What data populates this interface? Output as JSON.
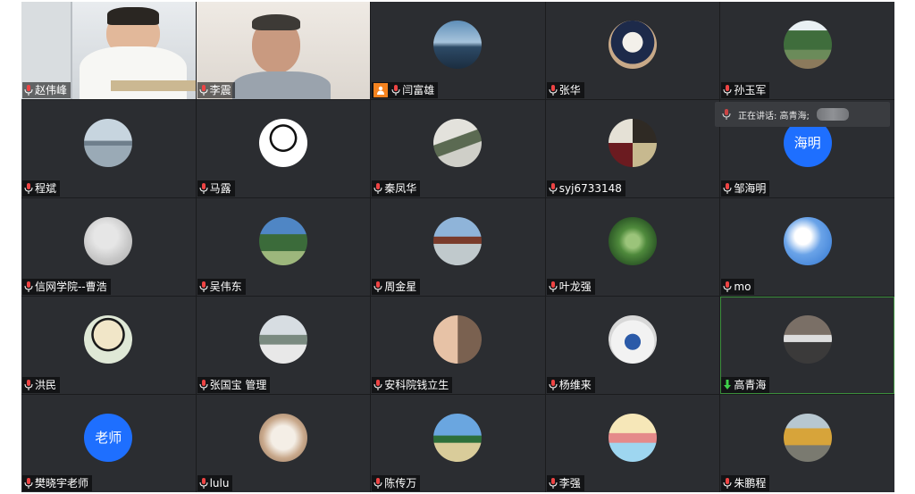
{
  "participants": [
    {
      "name": "赵伟峰",
      "kind": "video",
      "scene": "man-desk"
    },
    {
      "name": "李震",
      "kind": "video",
      "scene": "older-man"
    },
    {
      "name": "闫富雄",
      "kind": "photo",
      "scene": "lighthouse",
      "host": true
    },
    {
      "name": "张华",
      "kind": "photo",
      "scene": "cat"
    },
    {
      "name": "孙玉军",
      "kind": "photo",
      "scene": "forest"
    },
    {
      "name": "程斌",
      "kind": "photo",
      "scene": "city-lake"
    },
    {
      "name": "马露",
      "kind": "photo",
      "scene": "cartoon-boy"
    },
    {
      "name": "秦凤华",
      "kind": "photo",
      "scene": "office"
    },
    {
      "name": "syj6733148",
      "kind": "photo",
      "scene": "grid-tiles"
    },
    {
      "name": "邹海明",
      "kind": "text",
      "avatar_text": "海明",
      "color": "#1e6fff"
    },
    {
      "name": "信网学院--曹浩",
      "kind": "photo",
      "scene": "grey-ball"
    },
    {
      "name": "吴伟东",
      "kind": "photo",
      "scene": "garden"
    },
    {
      "name": "周金星",
      "kind": "photo",
      "scene": "pavilion"
    },
    {
      "name": "叶龙强",
      "kind": "photo",
      "scene": "succulent"
    },
    {
      "name": "mo",
      "kind": "photo",
      "scene": "sky"
    },
    {
      "name": "洪民",
      "kind": "photo",
      "scene": "cartoon-glasses"
    },
    {
      "name": "张国宝 管理",
      "kind": "photo",
      "scene": "building"
    },
    {
      "name": "安科院钱立生",
      "kind": "photo",
      "scene": "couple"
    },
    {
      "name": "杨维来",
      "kind": "photo",
      "scene": "kid"
    },
    {
      "name": "高青海",
      "kind": "photo",
      "scene": "river-rock",
      "speaking": true
    },
    {
      "name": "樊晓宇老师",
      "kind": "text",
      "avatar_text": "老师",
      "color": "#1e6fff"
    },
    {
      "name": "lulu",
      "kind": "photo",
      "scene": "white-cat"
    },
    {
      "name": "陈传万",
      "kind": "photo",
      "scene": "beach"
    },
    {
      "name": "李强",
      "kind": "photo",
      "scene": "cartoon-family"
    },
    {
      "name": "朱鹏程",
      "kind": "photo",
      "scene": "autumn-road"
    }
  ],
  "speaking_tip": {
    "label": "正在讲话: 高青海;"
  },
  "colors": {
    "tile_bg": "#2b2d31",
    "speaking_border": "#3c8f3c",
    "host_badge": "#f5831f"
  }
}
